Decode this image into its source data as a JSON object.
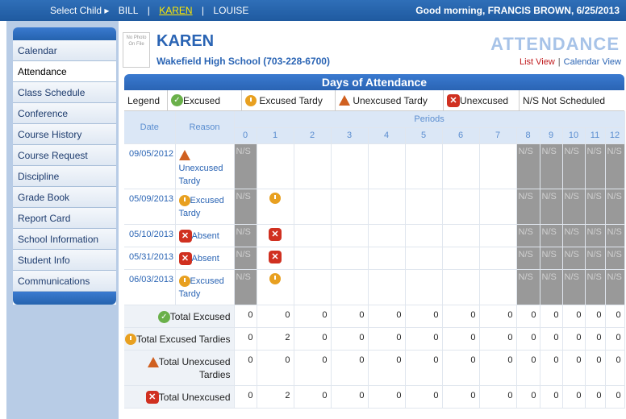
{
  "topbar": {
    "select_child": "Select Child ▸",
    "children": [
      "BILL",
      "KAREN",
      "LOUISE"
    ],
    "separator": "|",
    "greeting": "Good morning, FRANCIS BROWN, 6/25/2013"
  },
  "sidebar": {
    "items": [
      "Calendar",
      "Attendance",
      "Class Schedule",
      "Conference",
      "Course History",
      "Course Request",
      "Discipline",
      "Grade Book",
      "Report Card",
      "School Information",
      "Student Info",
      "Communications"
    ],
    "active": "Attendance"
  },
  "student": {
    "photo_text": "No Photo On File",
    "name": "KAREN",
    "school": "Wakefield High School (703-228-6700)"
  },
  "page": {
    "title": "ATTENDANCE",
    "list_view": "List View",
    "separator": "|",
    "calendar_view": "Calendar View"
  },
  "grid": {
    "title": "Days of Attendance",
    "legend": {
      "label": "Legend",
      "excused": "Excused",
      "excused_tardy": "Excused Tardy",
      "unexcused_tardy": "Unexcused Tardy",
      "unexcused": "Unexcused",
      "ns": "N/S Not Scheduled"
    },
    "headers": {
      "date": "Date",
      "reason": "Reason",
      "periods": "Periods"
    },
    "period_numbers": [
      "0",
      "1",
      "2",
      "3",
      "4",
      "5",
      "6",
      "7",
      "8",
      "9",
      "10",
      "11",
      "12"
    ],
    "rows": [
      {
        "date": "09/05/2012",
        "reason": "Unexcused Tardy",
        "icon": "unexcused-tardy"
      },
      {
        "date": "05/09/2013",
        "reason": "Excused Tardy",
        "icon": "excused-tardy"
      },
      {
        "date": "05/10/2013",
        "reason": "Absent",
        "icon": "unexcused"
      },
      {
        "date": "05/31/2013",
        "reason": "Absent",
        "icon": "unexcused"
      },
      {
        "date": "06/03/2013",
        "reason": "Excused Tardy",
        "icon": "excused-tardy"
      }
    ],
    "ns_label": "N/S",
    "totals": [
      {
        "label": "Total Excused",
        "icon": "excused",
        "values": [
          "0",
          "0",
          "0",
          "0",
          "0",
          "0",
          "0",
          "0",
          "0",
          "0",
          "0",
          "0",
          "0"
        ]
      },
      {
        "label": "Total Excused Tardies",
        "icon": "excused-tardy",
        "values": [
          "0",
          "2",
          "0",
          "0",
          "0",
          "0",
          "0",
          "0",
          "0",
          "0",
          "0",
          "0",
          "0"
        ]
      },
      {
        "label": "Total Unexcused Tardies",
        "icon": "unexcused-tardy",
        "values": [
          "0",
          "0",
          "0",
          "0",
          "0",
          "0",
          "0",
          "0",
          "0",
          "0",
          "0",
          "0",
          "0"
        ]
      },
      {
        "label": "Total Unexcused",
        "icon": "unexcused",
        "values": [
          "0",
          "2",
          "0",
          "0",
          "0",
          "0",
          "0",
          "0",
          "0",
          "0",
          "0",
          "0",
          "0"
        ]
      }
    ]
  },
  "colors": {
    "accent": "#2a64b4",
    "ns_gray": "#999999",
    "tardy": "#e8a020",
    "unexcused": "#d03020",
    "excused": "#6ab04a"
  }
}
